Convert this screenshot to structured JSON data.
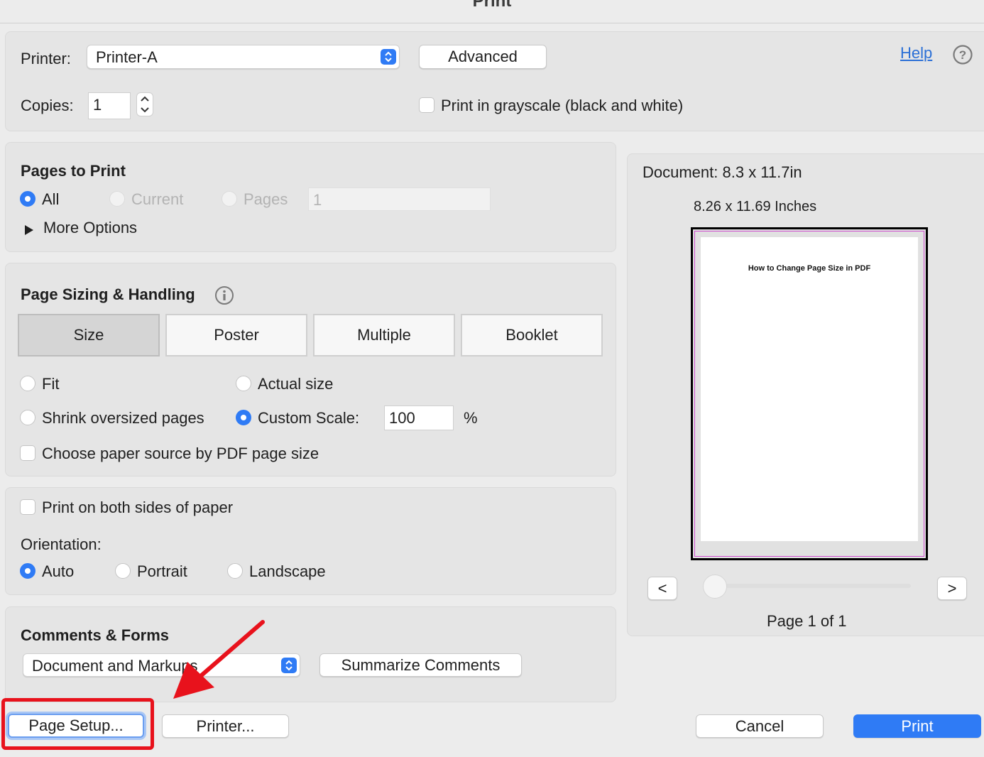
{
  "window": {
    "title": "Print"
  },
  "printer": {
    "label": "Printer:",
    "value": "Printer-A",
    "advanced_label": "Advanced"
  },
  "help": {
    "label": "Help",
    "icon": "question-circle-icon"
  },
  "copies": {
    "label": "Copies:",
    "value": "1"
  },
  "grayscale": {
    "label": "Print in grayscale (black and white)",
    "checked": false
  },
  "pages_to_print": {
    "heading": "Pages to Print",
    "all_label": "All",
    "current_label": "Current",
    "pages_label": "Pages",
    "pages_value": "1",
    "more_options_label": "More Options",
    "selected": "All"
  },
  "sizing": {
    "heading": "Page Sizing & Handling",
    "tabs": [
      "Size",
      "Poster",
      "Multiple",
      "Booklet"
    ],
    "selected_tab": "Size",
    "fit_label": "Fit",
    "actual_size_label": "Actual size",
    "shrink_label": "Shrink oversized pages",
    "custom_scale_label": "Custom Scale:",
    "custom_scale_value": "100",
    "percent_label": "%",
    "paper_source_label": "Choose paper source by PDF page size"
  },
  "duplex": {
    "label": "Print on both sides of paper"
  },
  "orientation": {
    "label": "Orientation:",
    "auto_label": "Auto",
    "portrait_label": "Portrait",
    "landscape_label": "Landscape",
    "selected": "Auto"
  },
  "comments": {
    "heading": "Comments & Forms",
    "select_value": "Document and Markups",
    "summarize_label": "Summarize Comments"
  },
  "preview": {
    "document_size": "Document: 8.3 x 11.7in",
    "page_size": "8.26 x 11.69 Inches",
    "page_heading": "How to Change Page Size in PDF",
    "prev_label": "<",
    "next_label": ">",
    "page_indicator": "Page 1 of 1"
  },
  "footer": {
    "page_setup_label": "Page Setup...",
    "printer_label": "Printer...",
    "cancel_label": "Cancel",
    "print_label": "Print"
  },
  "colors": {
    "accent": "#2f7bf5",
    "annotation": "#e8121c"
  }
}
